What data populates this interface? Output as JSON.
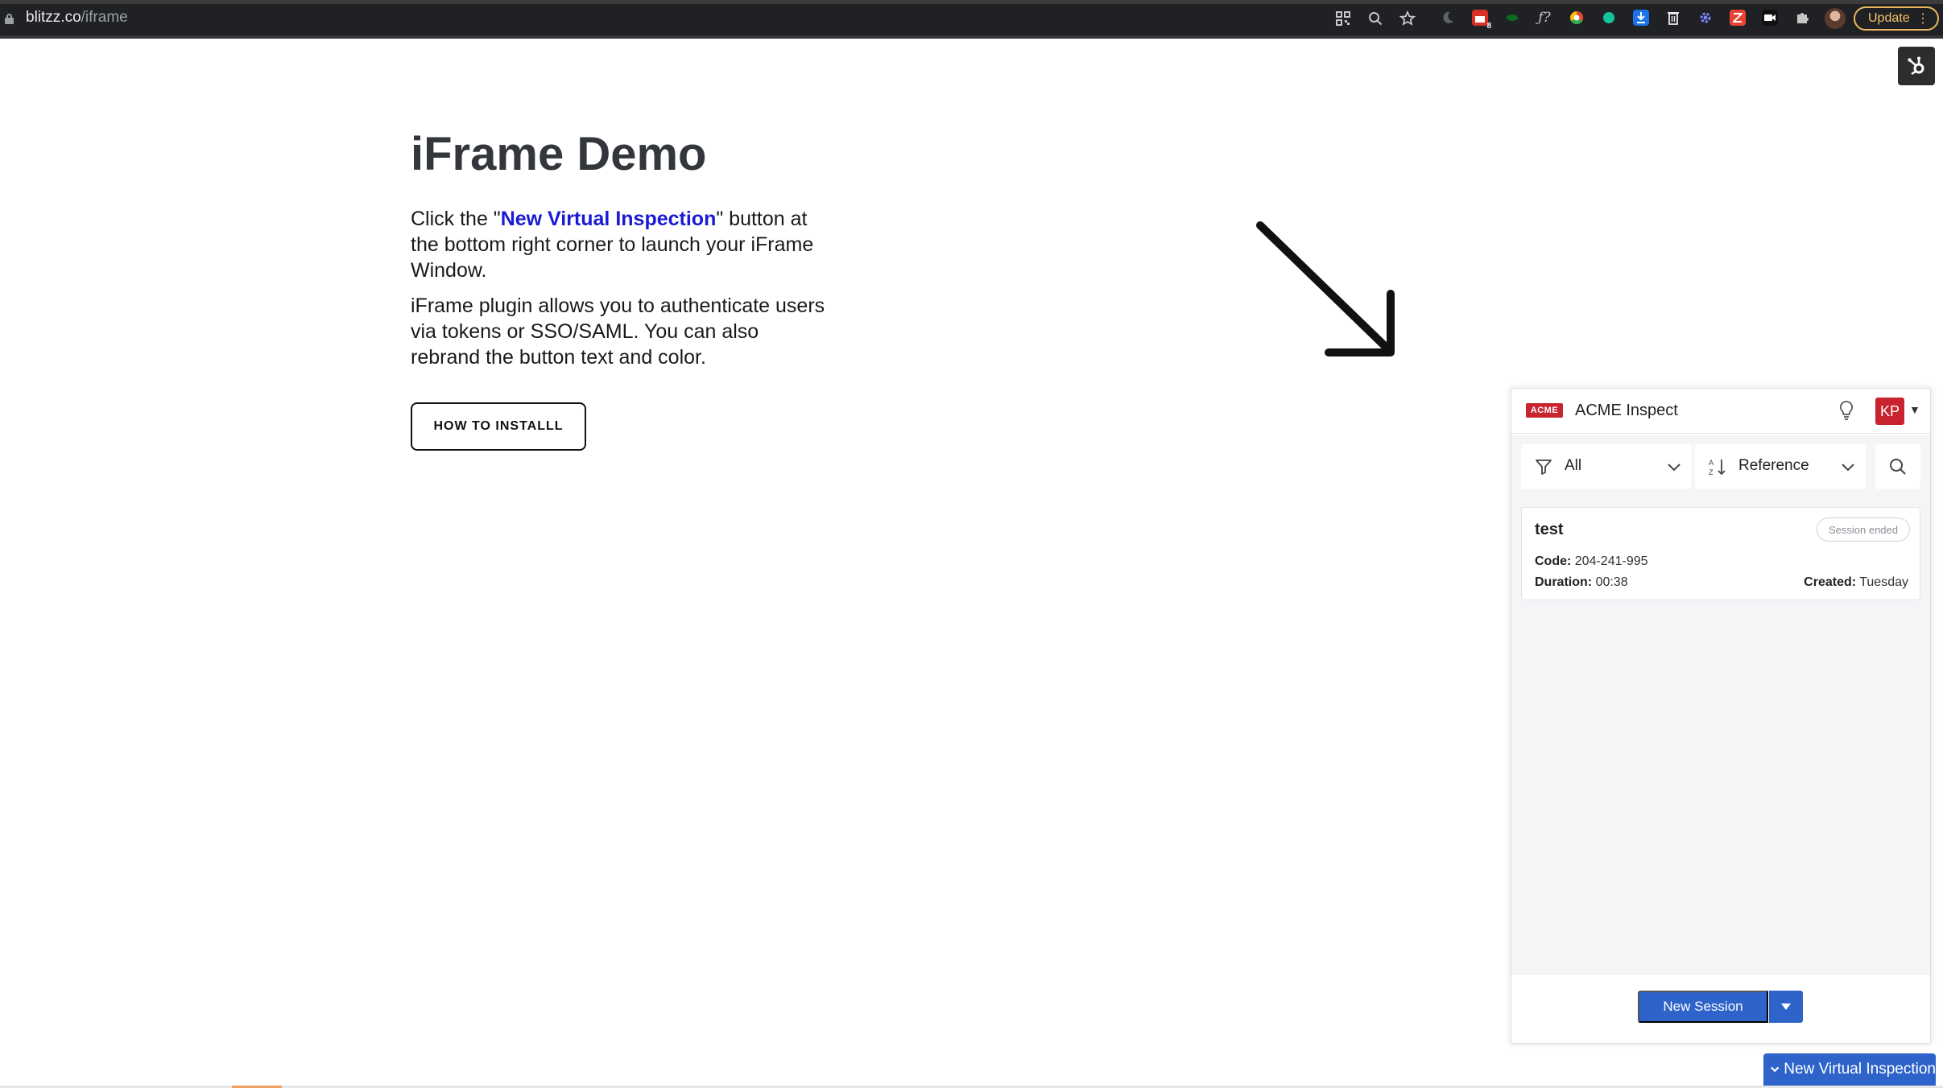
{
  "browser": {
    "url_domain": "blitzz.co",
    "url_path": "/iframe",
    "update_label": "Update",
    "update_menu_glyph": "⋮"
  },
  "page": {
    "title": "iFrame Demo",
    "para1_prefix": "Click the \"",
    "para1_link": "New Virtual Inspection",
    "para1_suffix": "\" button at the bottom right corner to launch your iFrame Window.",
    "para2": "iFrame plugin allows you to authenticate users via tokens or SSO/SAML. You can also rebrand the button text and color.",
    "install_button": "HOW TO INSTALLL"
  },
  "panel": {
    "logo_text": "ACME",
    "app_title": "ACME Inspect",
    "user_initials": "KP",
    "filter_label": "All",
    "sort_label": "Reference",
    "sessions": [
      {
        "title": "test",
        "status": "Session ended",
        "code_label": "Code:",
        "code": "204-241-995",
        "duration_label": "Duration:",
        "duration": "00:38",
        "created_label": "Created:",
        "created": "Tuesday"
      }
    ],
    "new_session_label": "New Session"
  },
  "launcher": {
    "label": "New Virtual Inspection"
  },
  "colors": {
    "brand_red": "#c8232f",
    "primary_blue": "#2e63c9",
    "link_blue": "#1a1ad6"
  }
}
